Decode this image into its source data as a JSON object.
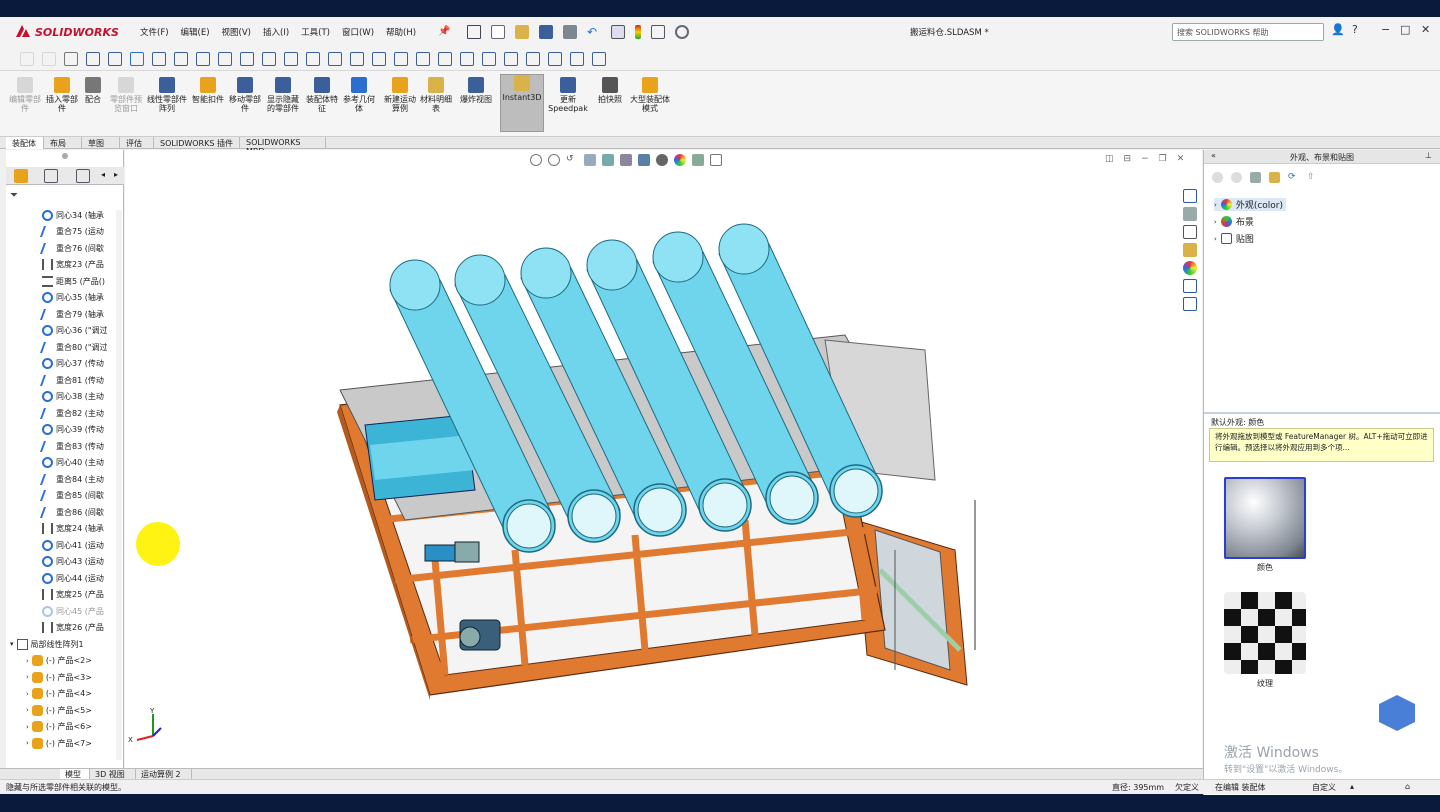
{
  "app": {
    "logo_text": "SOLIDWORKS",
    "document_title": "搬运料仓.SLDASM *"
  },
  "menu": [
    "文件(F)",
    "编辑(E)",
    "视图(V)",
    "插入(I)",
    "工具(T)",
    "窗口(W)",
    "帮助(H)"
  ],
  "search": {
    "placeholder": "搜索 SOLIDWORKS 帮助"
  },
  "ribbon": [
    {
      "label": "编辑零部件",
      "disabled": true
    },
    {
      "label": "插入零部件",
      "disabled": false
    },
    {
      "label": "配合",
      "disabled": false
    },
    {
      "label": "零部件预览窗口",
      "disabled": true
    },
    {
      "label": "线性零部件阵列",
      "disabled": false
    },
    {
      "label": "智能扣件",
      "disabled": false
    },
    {
      "label": "移动零部件",
      "disabled": false
    },
    {
      "label": "显示隐藏的零部件",
      "disabled": false
    },
    {
      "label": "装配体特征",
      "disabled": false
    },
    {
      "label": "参考几何体",
      "disabled": false
    },
    {
      "label": "新建运动算例",
      "disabled": false
    },
    {
      "label": "材料明细表",
      "disabled": false
    },
    {
      "label": "爆炸视图",
      "disabled": false
    },
    {
      "label": "Instant3D",
      "disabled": false
    },
    {
      "label": "更新Speedpak",
      "disabled": false
    },
    {
      "label": "拍快照",
      "disabled": false
    },
    {
      "label": "大型装配体模式",
      "disabled": false
    }
  ],
  "command_tabs": [
    "装配体",
    "布局",
    "草图",
    "评估",
    "SOLIDWORKS 插件",
    "SOLIDWORKS MBD"
  ],
  "tree": [
    {
      "label": "同心34 (轴承",
      "type": "concentric",
      "indent": 1
    },
    {
      "label": "重合75 (运动",
      "type": "coincident",
      "indent": 1
    },
    {
      "label": "重合76 (间歇",
      "type": "coincident",
      "indent": 1
    },
    {
      "label": "宽度23 (产品",
      "type": "width",
      "indent": 1
    },
    {
      "label": "距离5 (产品()",
      "type": "distance",
      "indent": 1
    },
    {
      "label": "同心35 (轴承",
      "type": "concentric",
      "indent": 1
    },
    {
      "label": "重合79 (轴承",
      "type": "coincident",
      "indent": 1
    },
    {
      "label": "同心36 (\"调过",
      "type": "concentric",
      "indent": 1
    },
    {
      "label": "重合80 (\"调过",
      "type": "coincident",
      "indent": 1
    },
    {
      "label": "同心37 (传动",
      "type": "concentric",
      "indent": 1
    },
    {
      "label": "重合81 (传动",
      "type": "coincident",
      "indent": 1
    },
    {
      "label": "同心38 (主动",
      "type": "concentric",
      "indent": 1
    },
    {
      "label": "重合82 (主动",
      "type": "coincident",
      "indent": 1
    },
    {
      "label": "同心39 (传动",
      "type": "concentric",
      "indent": 1
    },
    {
      "label": "重合83 (传动",
      "type": "coincident",
      "indent": 1
    },
    {
      "label": "同心40 (主动",
      "type": "concentric",
      "indent": 1
    },
    {
      "label": "重合84 (主动",
      "type": "coincident",
      "indent": 1
    },
    {
      "label": "重合85 (间歇",
      "type": "coincident",
      "indent": 1
    },
    {
      "label": "重合86 (间歇",
      "type": "coincident",
      "indent": 1
    },
    {
      "label": "宽度24 (轴承",
      "type": "width",
      "indent": 1
    },
    {
      "label": "同心41 (运动",
      "type": "concentric",
      "indent": 1
    },
    {
      "label": "同心43 (运动",
      "type": "concentric",
      "indent": 1
    },
    {
      "label": "同心44 (运动",
      "type": "concentric",
      "indent": 1
    },
    {
      "label": "宽度25 (产品",
      "type": "width",
      "indent": 1
    },
    {
      "label": "同心45 (产品",
      "type": "concentric",
      "indent": 1,
      "dim": true
    },
    {
      "label": "宽度26 (产品",
      "type": "width",
      "indent": 1
    },
    {
      "label": "局部线性阵列1",
      "type": "pattern",
      "indent": 0
    },
    {
      "label": "(-) 产品<2>",
      "type": "part",
      "indent": 2
    },
    {
      "label": "(-) 产品<3>",
      "type": "part",
      "indent": 2
    },
    {
      "label": "(-) 产品<4>",
      "type": "part",
      "indent": 2
    },
    {
      "label": "(-) 产品<5>",
      "type": "part",
      "indent": 2
    },
    {
      "label": "(-) 产品<6>",
      "type": "part",
      "indent": 2
    },
    {
      "label": "(-) 产品<7>",
      "type": "part",
      "indent": 2
    }
  ],
  "bottom_tabs": [
    "模型",
    "3D 视图",
    "运动算例 2"
  ],
  "right_panel": {
    "title": "外观、布景和贴图",
    "items": [
      {
        "label": "外观(color)"
      },
      {
        "label": "布景"
      },
      {
        "label": "贴图"
      }
    ],
    "default_appearance": "默认外观: 颜色",
    "tooltip": "将外观拖放到模型或 FeatureManager 树。ALT+拖动可立即进行编辑。预选择以将外观应用到多个项...",
    "swatches": [
      {
        "label": "颜色"
      },
      {
        "label": "纹理"
      }
    ],
    "watermark_title": "激活 Windows",
    "watermark_sub": "转到\"设置\"以激活 Windows。"
  },
  "status": {
    "message": "隐藏与所选零部件相关联的模型。",
    "diameter": "直径: 395mm",
    "definition": "欠定义",
    "mode": "在编辑 装配体",
    "custom": "自定义"
  },
  "colors": {
    "frame": "#e2762a",
    "tube": "#6fd5ec",
    "accent_blue": "#2a8fc4"
  }
}
